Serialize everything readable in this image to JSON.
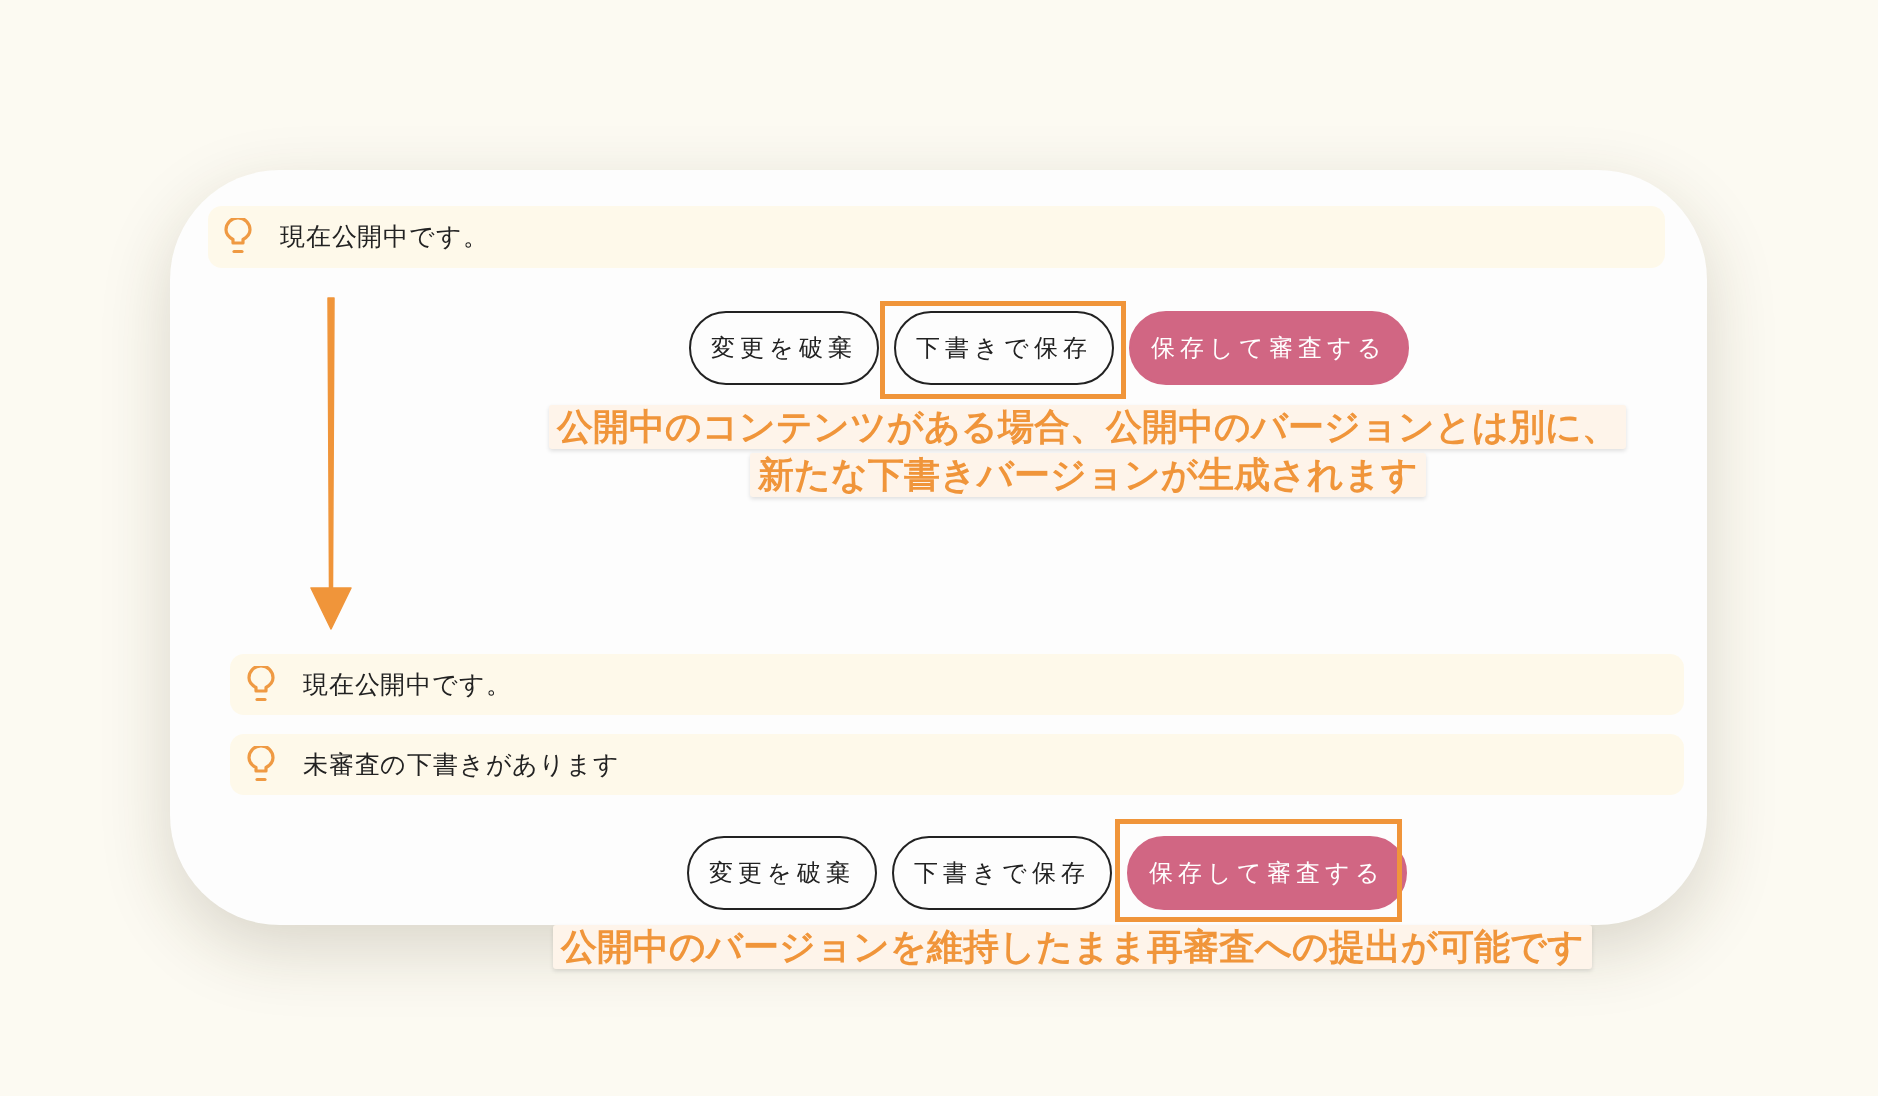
{
  "steps": [
    {
      "banners": [
        {
          "text": "現在公開中です。"
        }
      ],
      "buttons": [
        {
          "label": "変更を破棄",
          "kind": "outline",
          "highlighted": false
        },
        {
          "label": "下書きで保存",
          "kind": "outline",
          "highlighted": true
        },
        {
          "label": "保存して審査する",
          "kind": "primary",
          "highlighted": false
        }
      ],
      "note": {
        "lines": [
          "公開中のコンテンツがある場合、公開中のバージョンとは別に、",
          "新たな下書きバージョンが生成されます"
        ]
      }
    },
    {
      "banners": [
        {
          "text": "現在公開中です。"
        },
        {
          "text": "未審査の下書きがあります"
        }
      ],
      "buttons": [
        {
          "label": "変更を破棄",
          "kind": "outline",
          "highlighted": false
        },
        {
          "label": "下書きで保存",
          "kind": "outline",
          "highlighted": false
        },
        {
          "label": "保存して審査する",
          "kind": "primary",
          "highlighted": true
        }
      ],
      "note": {
        "lines": [
          "公開中のバージョンを維持したまま再審査への提出が可能です"
        ]
      }
    }
  ]
}
